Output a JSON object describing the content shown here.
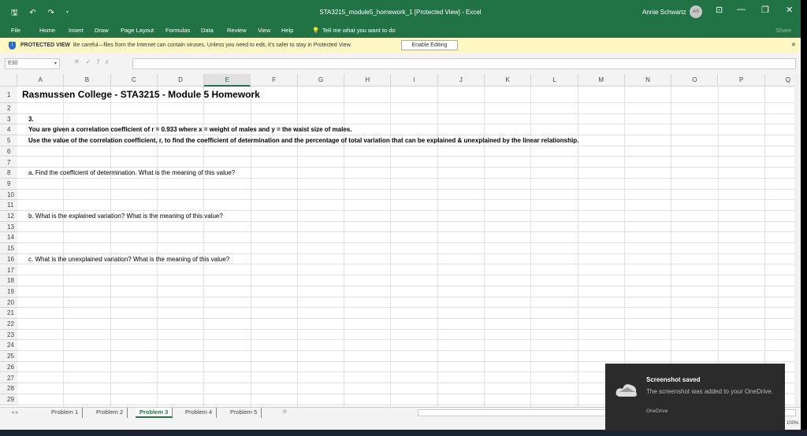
{
  "window": {
    "title": "STA3215_module5_homework_1  [Protected View]  -  Excel",
    "user": "Annie Schwartz",
    "user_initials": "AS",
    "share": "Share"
  },
  "menu": [
    "File",
    "Home",
    "Insert",
    "Draw",
    "Page Layout",
    "Formulas",
    "Data",
    "Review",
    "View",
    "Help"
  ],
  "tell_me": "Tell me what you want to do",
  "protected": {
    "label": "PROTECTED VIEW",
    "message": "Be careful—files from the Internet can contain viruses. Unless you need to edit, it's safer to stay in Protected View.",
    "button": "Enable Editing"
  },
  "formula_bar": {
    "name_box": "E30",
    "fx": "fx",
    "value": ""
  },
  "columns": [
    "A",
    "B",
    "C",
    "D",
    "E",
    "F",
    "G",
    "H",
    "I",
    "J",
    "K",
    "L",
    "M",
    "N",
    "O",
    "P",
    "Q"
  ],
  "selected_column": "E",
  "rows": [
    {
      "n": "1",
      "text": "Rasmussen College - STA3215 - Module 5 Homework",
      "style": "title"
    },
    {
      "n": "2",
      "text": ""
    },
    {
      "n": "3",
      "text": "3.",
      "style": "bold"
    },
    {
      "n": "4",
      "text": "You are given a correlation coefficient of r = 0.933 where x = weight of males and y = the waist size of males.",
      "style": "bold"
    },
    {
      "n": "5",
      "text": "Use the value of the correlation coefficient, r,  to find the coefficient of determination and the percentage of total variation that can be explained & unexplained by the linear relationship.",
      "style": "bold"
    },
    {
      "n": "6",
      "text": ""
    },
    {
      "n": "7",
      "text": ""
    },
    {
      "n": "8",
      "text": "a. Find the coefficient of determination. What is the meaning of this value?"
    },
    {
      "n": "9",
      "text": ""
    },
    {
      "n": "10",
      "text": ""
    },
    {
      "n": "11",
      "text": ""
    },
    {
      "n": "12",
      "text": "b. What is the explained variation?  What is the meaning of this value?"
    },
    {
      "n": "13",
      "text": ""
    },
    {
      "n": "14",
      "text": ""
    },
    {
      "n": "15",
      "text": ""
    },
    {
      "n": "16",
      "text": "c. What is the unexplained variation?  What is the meaning of this value?"
    },
    {
      "n": "17",
      "text": ""
    },
    {
      "n": "18",
      "text": ""
    },
    {
      "n": "19",
      "text": ""
    },
    {
      "n": "20",
      "text": ""
    },
    {
      "n": "21",
      "text": ""
    },
    {
      "n": "22",
      "text": ""
    },
    {
      "n": "23",
      "text": ""
    },
    {
      "n": "24",
      "text": ""
    },
    {
      "n": "25",
      "text": ""
    },
    {
      "n": "26",
      "text": ""
    },
    {
      "n": "27",
      "text": ""
    },
    {
      "n": "28",
      "text": ""
    },
    {
      "n": "29",
      "text": ""
    }
  ],
  "sheets": [
    "Problem 1",
    "Problem 2",
    "Problem 3",
    "Problem 4",
    "Problem 5"
  ],
  "active_sheet": "Problem 3",
  "zoom": "100%",
  "toast": {
    "title": "Screenshot saved",
    "body": "The screenshot was added to your OneDrive.",
    "source": "OneDrive"
  }
}
